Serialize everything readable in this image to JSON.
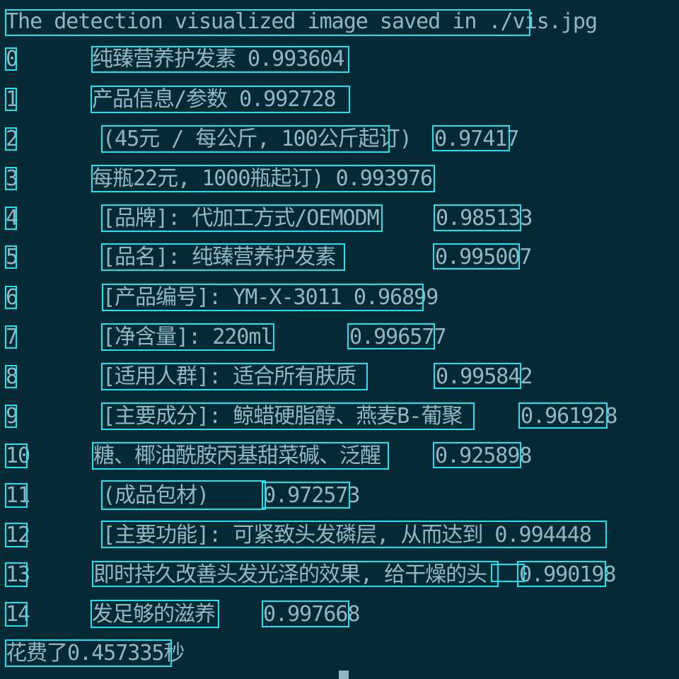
{
  "terminal": {
    "header": "The detection visualized image saved in ./vis.jpg",
    "rows": [
      {
        "index": "0",
        "text": "纯臻营养护发素  0.993604",
        "score": ""
      },
      {
        "index": "1",
        "text": "产品信息/参数   0.992728",
        "score": ""
      },
      {
        "index": "2",
        "text": "(45元 / 每公斤, 100公斤起订)",
        "score": "0.97417"
      },
      {
        "index": "3",
        "text": "每瓶22元, 1000瓶起订)   0.993976",
        "score": ""
      },
      {
        "index": "4",
        "text": "[品牌]: 代加工方式/OEMODM",
        "score": "0.985133"
      },
      {
        "index": "5",
        "text": "[品名]: 纯臻营养护发素",
        "score": "0.995007"
      },
      {
        "index": "6",
        "text": "[产品编号]: YM-X-3011 0.96899",
        "score": ""
      },
      {
        "index": "7",
        "text": "[净含量]: 220ml",
        "score": "0.996577"
      },
      {
        "index": "8",
        "text": "[适用人群]: 适合所有肤质",
        "score": "0.995842"
      },
      {
        "index": "9",
        "text": "[主要成分]: 鲸蜡硬脂醇、燕麦B-葡聚",
        "score": "0.961928"
      },
      {
        "index": "10",
        "text": "糖、椰油酰胺丙基甜菜碱、泛醒",
        "score": "0.925898"
      },
      {
        "index": "11",
        "text": "(成品包材)",
        "score": "0.972573"
      },
      {
        "index": "12",
        "text": "[主要功能]: 可紧致头发磷层, 从而达到  0.994448",
        "score": ""
      },
      {
        "index": "13",
        "text": "即时持久改善头发光泽的效果, 给干燥的头",
        "score": "0.990198"
      },
      {
        "index": "14",
        "text": "发足够的滋养",
        "score": "0.997668"
      }
    ],
    "footer": "花费了0.457335秒"
  },
  "colors": {
    "background": "#062a35",
    "text": "#8fb8c4",
    "box": "#1fe3ee"
  }
}
